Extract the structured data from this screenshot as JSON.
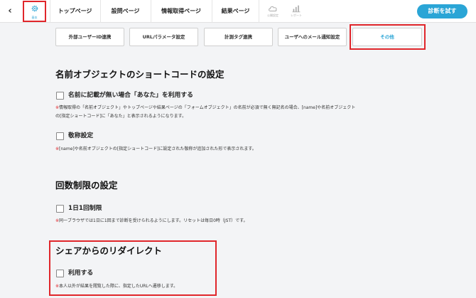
{
  "topbar": {
    "back_label": "‹",
    "settings_label": "基本",
    "tabs": [
      "トップページ",
      "設問ページ",
      "情報取得ページ",
      "結果ページ"
    ],
    "publish_label": "公開設定",
    "report_label": "レポート",
    "diagnose_button": "診断を試す"
  },
  "subtabs": [
    "外部ユーザーID連携",
    "URLパラメータ設定",
    "計測タグ連携",
    "ユーザへのメール通知設定",
    "その他"
  ],
  "name_section": {
    "title": "名前オブジェクトのショートコードの設定",
    "option1_label": "名前に記載が無い場合「あなた」を利用する",
    "option1_note_mark": "※",
    "option1_note_line1": "情報取得の「名前オブジェクト」やトップページや結果ページの「フォームオブジェクト」の名前が必須で無く無記名の場合、[name]や名前オブジェクト",
    "option1_note_line2": "の[指定ショートコード]に「あなた」と表示されるようになります。",
    "option2_label": "敬称設定",
    "option2_note_mark": "※",
    "option2_note": "[name]や名前オブジェクトの[指定ショートコード]に設定された敬称が追加された形で表示されます。"
  },
  "limit_section": {
    "title": "回数制限の設定",
    "option_label": "1日1回制限",
    "note_mark": "※",
    "note": "同一ブラウザでは1日に1回まで診断を受けられるようにします。リセットは毎日0時（JST）です。"
  },
  "redirect_section": {
    "title": "シェアからのリダイレクト",
    "option_label": "利用する",
    "note_mark": "※",
    "note": "本人以外が結果を閲覧した際に、指定したURLへ遷移します。"
  },
  "colors": {
    "accent": "#2aa5d6",
    "highlight": "#e0262b",
    "background": "#f3f4f6"
  }
}
